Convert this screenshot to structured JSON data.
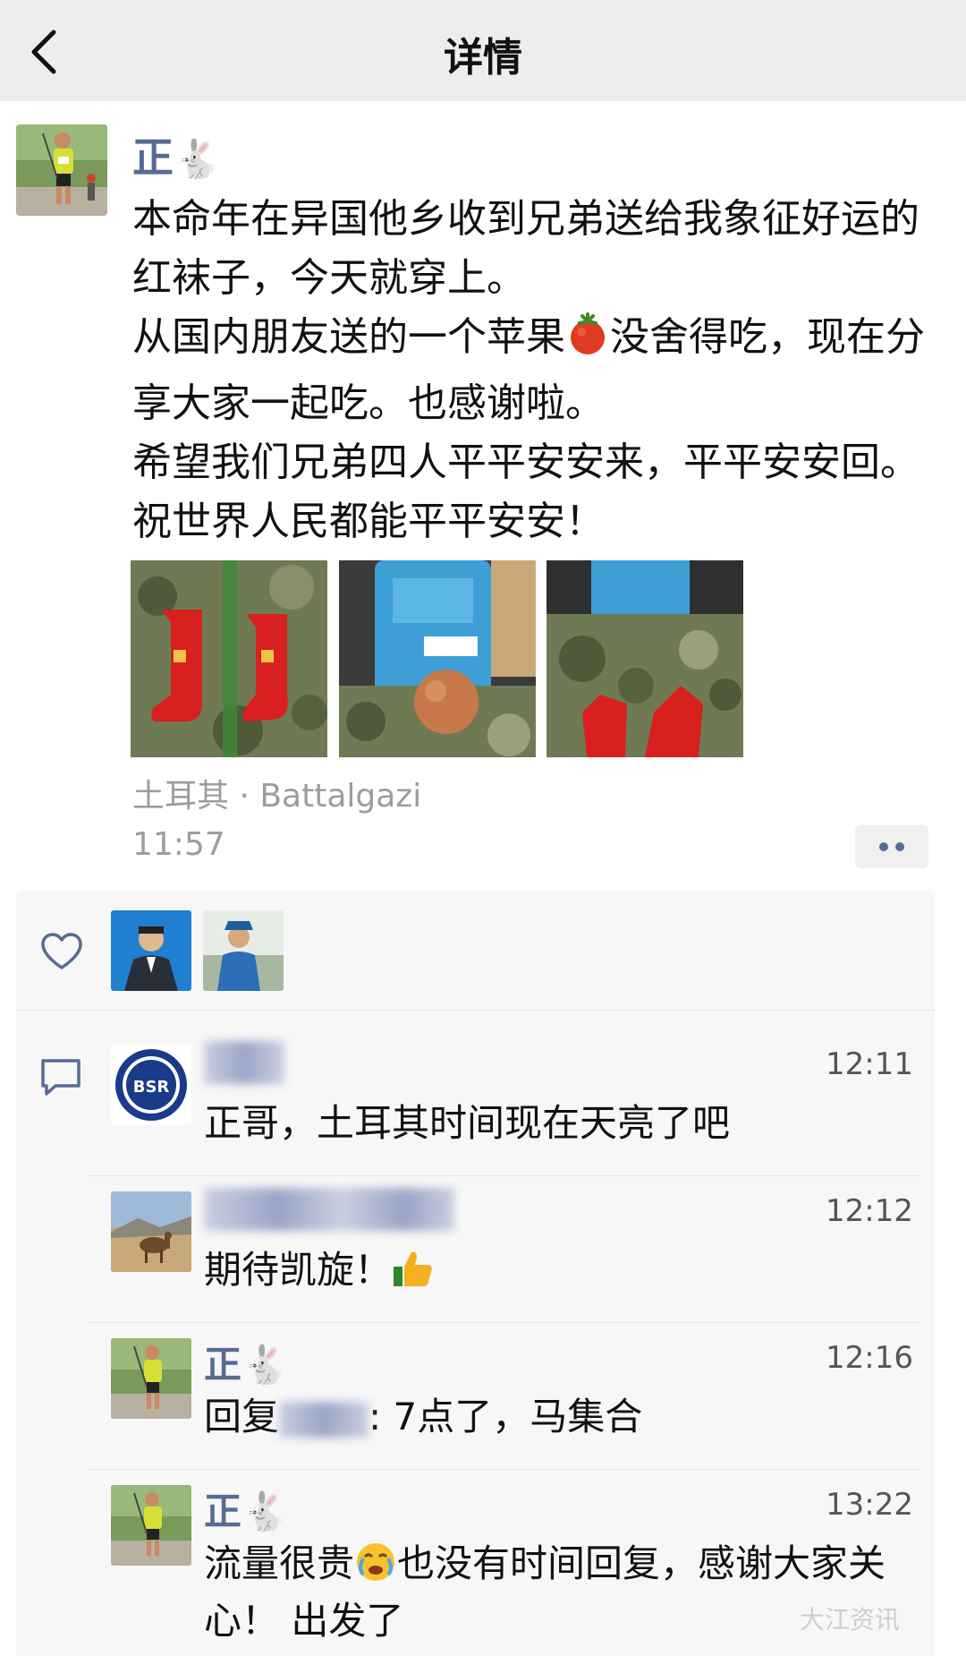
{
  "nav": {
    "title": "详情"
  },
  "post": {
    "author": "正",
    "author_emoji": "🐇",
    "lines": [
      "本命年在异国他乡收到兄弟送给我象征好运的红袜子，今天就穿上。",
      "从国内朋友送的一个苹果",
      "没舍得吃，现在分享大家一起吃。也感谢啦。",
      "希望我们兄弟四人平平安安来，平平安安回。祝世界人民都能平平安安！"
    ],
    "location": "土耳其 · Battalgazi",
    "time": "11:57"
  },
  "comments": [
    {
      "name_blurred": true,
      "time": "12:11",
      "text": "正哥，土耳其时间现在天亮了吧"
    },
    {
      "name_blurred": true,
      "time": "12:12",
      "text": "期待凯旋！"
    },
    {
      "name": "正",
      "name_emoji": "🐇",
      "time": "12:16",
      "text_prefix": "回复",
      "text_suffix": ":  7点了，马集合"
    },
    {
      "name": "正",
      "name_emoji": "🐇",
      "time": "13:22",
      "text_a": "流量很贵",
      "text_b": "也没有时间回复，感谢大家关心！ 出发了"
    }
  ],
  "watermark": "大江资讯"
}
